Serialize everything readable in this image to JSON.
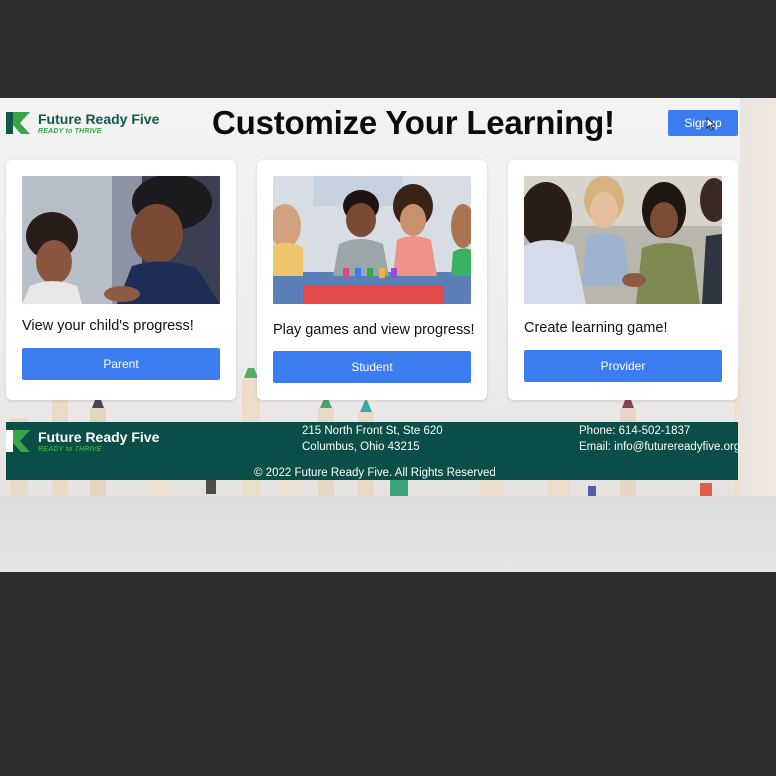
{
  "brand": {
    "name": "Future Ready Five",
    "tagline": "READY to THRIVE",
    "primary_color": "#0e5a49",
    "accent_color": "#3aa44a"
  },
  "header": {
    "title": "Customize Your Learning!",
    "signup_label": "Signup"
  },
  "cards": [
    {
      "caption": "View your child's progress!",
      "button_label": "Parent",
      "image": "parent-and-child-photo"
    },
    {
      "caption": "Play games and view progress!",
      "button_label": "Student",
      "image": "children-painting-photo"
    },
    {
      "caption": "Create learning game!",
      "button_label": "Provider",
      "image": "teachers-meeting-photo"
    }
  ],
  "footer": {
    "address_line1": "215 North Front St, Ste 620",
    "address_line2": "Columbus, Ohio 43215",
    "phone": "Phone: 614-502-1837",
    "email": "Email: info@futurereadyfive.org",
    "copyright": "© 2022 Future Ready Five. All Rights Reserved",
    "background_color": "#0b4d47"
  },
  "colors": {
    "button": "#3b7cf0",
    "outer_frame": "#2b2d2f"
  }
}
